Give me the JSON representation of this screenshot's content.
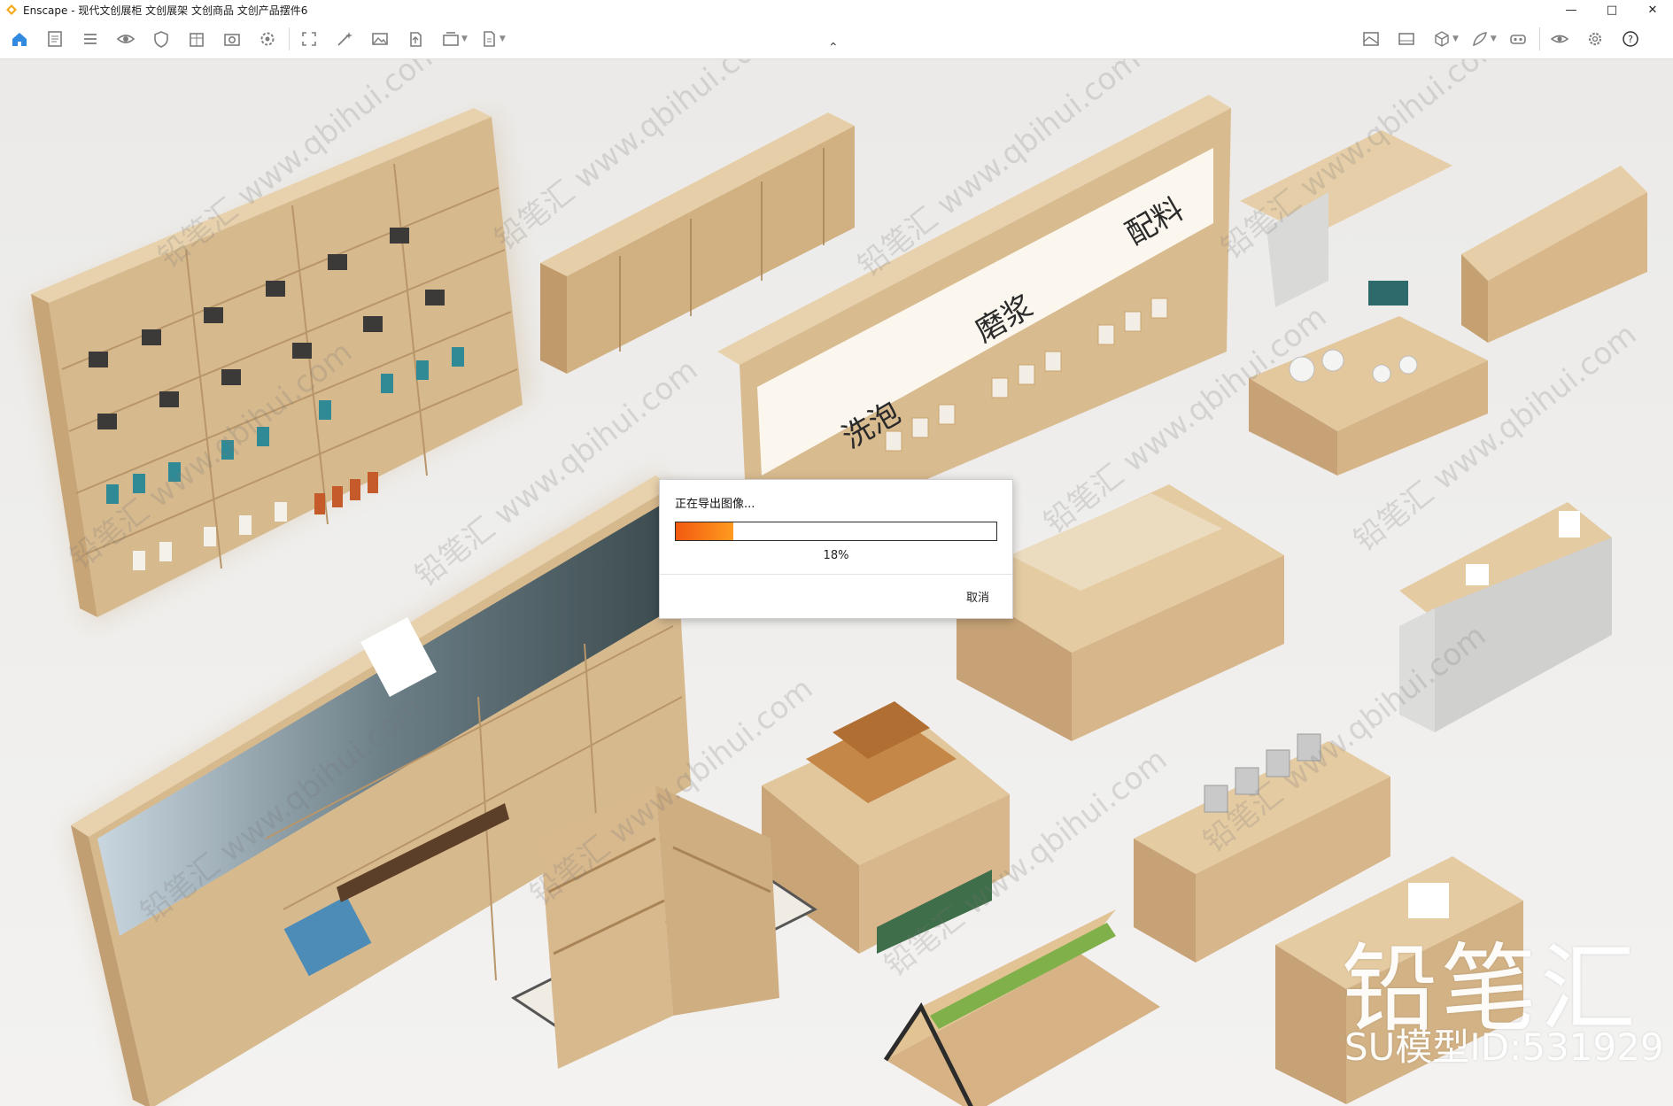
{
  "window": {
    "title": "Enscape - 现代文创展柜 文创展架 文创商品 文创产品摆件6",
    "controls": [
      "minimize",
      "maximize",
      "close"
    ]
  },
  "toolbar": {
    "left_icons": [
      "home-icon",
      "document-icon",
      "list-icon",
      "eye-icon",
      "shield-icon",
      "building-icon",
      "camera-settings-icon",
      "gear-wheel-icon",
      "frame-icon",
      "magic-wand-icon",
      "image-icon",
      "upload-icon",
      "batch-icon",
      "export-icon"
    ],
    "right_icons": [
      "map-icon",
      "panorama-icon",
      "cube-icon",
      "feather-icon",
      "vr-headset-icon",
      "visibility-icon",
      "settings-icon",
      "help-icon"
    ]
  },
  "dialog": {
    "message": "正在导出图像...",
    "progress": 0.18,
    "progress_label": "18%",
    "cancel_label": "取消"
  },
  "watermark": {
    "brand": "铅笔汇",
    "model_id": "SU模型ID:531929",
    "tile_text": "铅笔汇 www.qbihui.com"
  },
  "colors": {
    "wood": "#d9b98d",
    "progress": "#f47a17"
  }
}
